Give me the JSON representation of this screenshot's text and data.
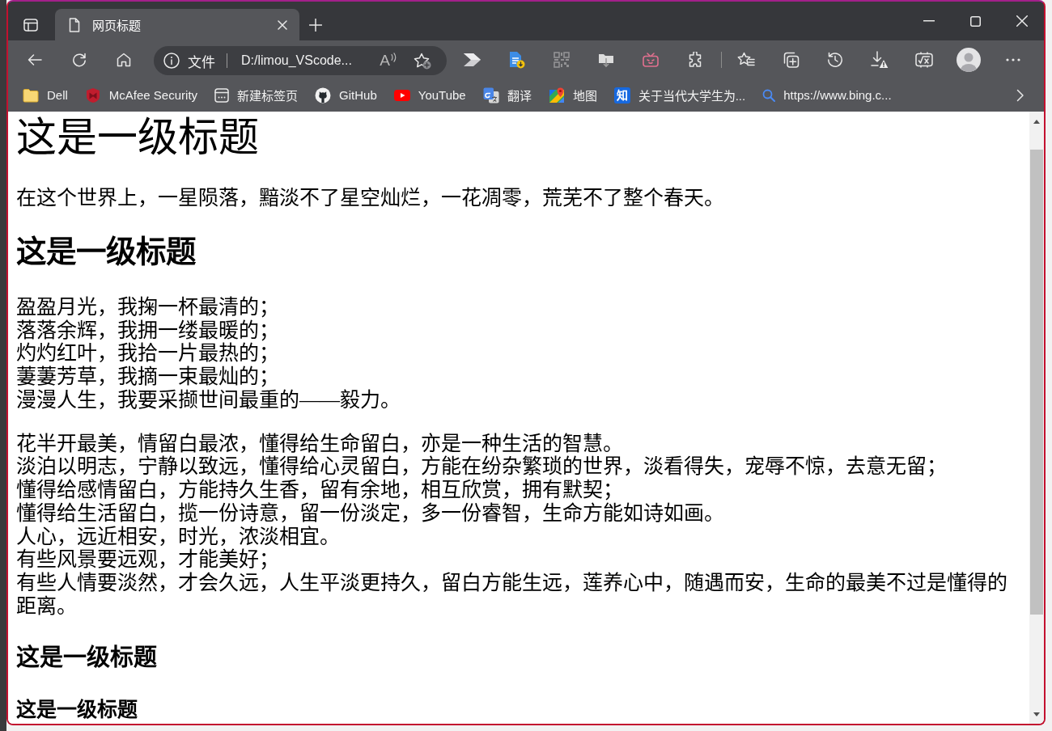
{
  "tab_bar": {
    "tabs": [
      {
        "title": "网页标题",
        "selected": true
      }
    ]
  },
  "toolbar": {
    "address_bar": {
      "site_label": "文件",
      "url": "D:/limou_VScode...",
      "read_aloud_glyph": "A"
    },
    "extensions": [
      {
        "kind": "chevron",
        "disabled": false
      },
      {
        "kind": "document",
        "disabled": false
      },
      {
        "kind": "qrcode",
        "disabled": true
      },
      {
        "kind": "folder",
        "disabled": false
      },
      {
        "kind": "tv",
        "disabled": false
      },
      {
        "kind": "puzzle",
        "disabled": false
      }
    ]
  },
  "bookmarks_bar": {
    "items": [
      {
        "kind": "folder",
        "label": "Dell"
      },
      {
        "kind": "shield",
        "label": "McAfee Security"
      },
      {
        "kind": "newtab",
        "label": "新建标签页"
      },
      {
        "kind": "github",
        "label": "GitHub"
      },
      {
        "kind": "youtube",
        "label": "YouTube"
      },
      {
        "kind": "translate",
        "label": "翻译"
      },
      {
        "kind": "map",
        "label": "地图"
      },
      {
        "kind": "glyph",
        "glyph": "知",
        "label": "关于当代大学生为..."
      },
      {
        "kind": "search",
        "label": "https://www.bing.c..."
      }
    ]
  },
  "page": {
    "blocks": [
      {
        "kind": "h1",
        "text": "这是一级标题"
      },
      {
        "kind": "paragraph",
        "lines": [
          "在这个世界上，一星陨落，黯淡不了星空灿烂，一花凋零，荒芜不了整个春天。"
        ]
      },
      {
        "kind": "h2",
        "text": "这是一级标题"
      },
      {
        "kind": "paragraph",
        "lines": [
          "盈盈月光，我掬一杯最清的；",
          "落落余辉，我拥一缕最暖的；",
          "灼灼红叶，我拾一片最热的；",
          "萋萋芳草，我摘一束最灿的；",
          "漫漫人生，我要采撷世间最重的——毅力。"
        ]
      },
      {
        "kind": "paragraph",
        "lines": [
          "花半开最美，情留白最浓，懂得给生命留白，亦是一种生活的智慧。",
          "淡泊以明志，宁静以致远，懂得给心灵留白，方能在纷杂繁琐的世界，淡看得失，宠辱不惊，去意无留；",
          "懂得给感情留白，方能持久生香，留有余地，相互欣赏，拥有默契；",
          "懂得给生活留白，揽一份诗意，留一份淡定，多一份睿智，生命方能如诗如画。",
          "人心，远近相安，时光，浓淡相宜。",
          "有些风景要远观，才能美好；",
          "有些人情要淡然，才会久远，人生平淡更持久，留白方能生远，莲养心中，随遇而安，生命的最美不过是懂得的距离。"
        ]
      },
      {
        "kind": "h3",
        "text": "这是一级标题"
      },
      {
        "kind": "h4",
        "text": "这是一级标题"
      }
    ]
  }
}
